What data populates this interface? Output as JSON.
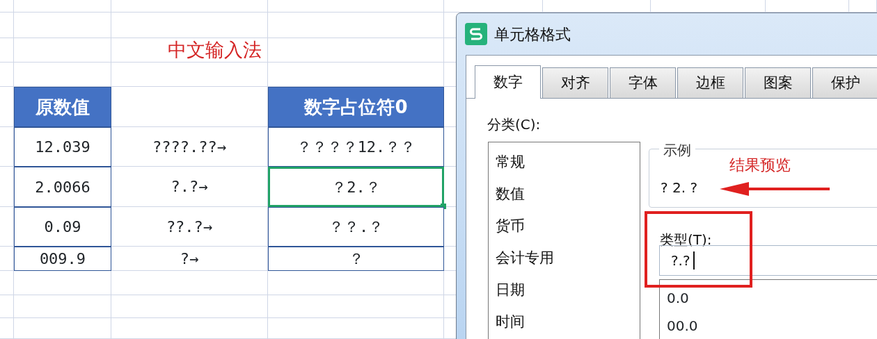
{
  "sheet": {
    "annotation": "中文输入法",
    "header": {
      "column_1": "原数值",
      "column_3": "数字占位符0"
    },
    "rows": [
      {
        "original": "12.039",
        "format": "????.??→",
        "result": "？？？？12.？？",
        "selected": false
      },
      {
        "original": "2.0066",
        "format": "?.?→",
        "result": "？2.？",
        "selected": true
      },
      {
        "original": "0.09",
        "format": "??.?→",
        "result": "？？.？",
        "selected": false
      },
      {
        "original": "009.9",
        "format": "?→",
        "result": "？",
        "selected": false
      }
    ]
  },
  "dialog": {
    "title": "单元格格式",
    "tabs": [
      {
        "label": "数字",
        "selected": true
      },
      {
        "label": "对齐",
        "selected": false
      },
      {
        "label": "字体",
        "selected": false
      },
      {
        "label": "边框",
        "selected": false
      },
      {
        "label": "图案",
        "selected": false
      },
      {
        "label": "保护",
        "selected": false
      }
    ],
    "category_label": "分类(C):",
    "categories": [
      "常规",
      "数值",
      "货币",
      "会计专用",
      "日期",
      "时间"
    ],
    "sample": {
      "legend": "示例",
      "annotation": "结果预览",
      "value": "? 2. ?"
    },
    "type": {
      "label": "类型(T):",
      "value": "?.?",
      "options": [
        "0.0",
        "00.0"
      ]
    }
  }
}
